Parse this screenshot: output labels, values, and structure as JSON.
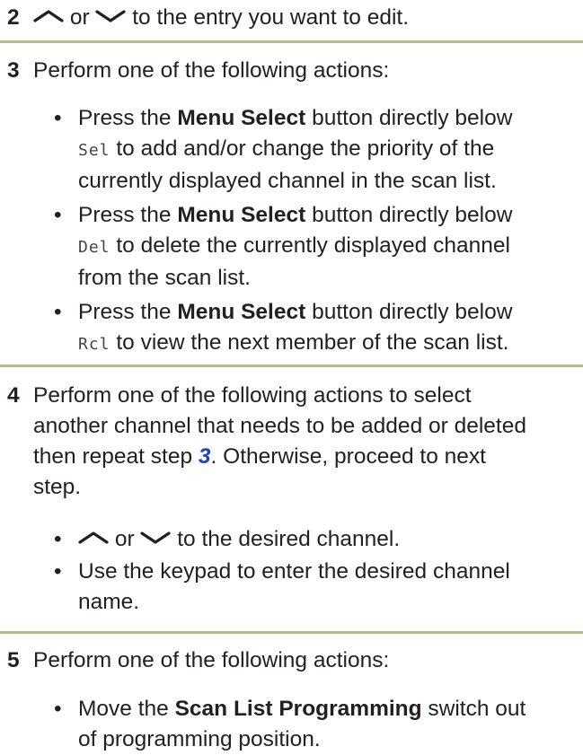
{
  "step2": {
    "number": "2",
    "or": "or",
    "text": "to the entry you want to edit.",
    "up_icon": "chevron-up-icon",
    "down_icon": "chevron-down-icon"
  },
  "step3": {
    "number": "3",
    "text": "Perform one of the following actions:",
    "bullets": [
      {
        "pre": "Press the",
        "bold": "Menu Select",
        "post": "button directly below",
        "key": "Sel",
        "post2": "to add and/or change the priority of the",
        "line3": "currently displayed channel in the scan list."
      },
      {
        "pre": "Press the",
        "bold": "Menu Select",
        "post": "button directly below",
        "key": "Del",
        "post2": "to delete the currently displayed channel",
        "line3": "from the scan list."
      },
      {
        "pre": "Press the",
        "bold": "Menu Select",
        "post": "button directly below",
        "key": "Rcl",
        "post2": "to view the next member of the scan list."
      }
    ]
  },
  "step4": {
    "number": "4",
    "line1": "Perform one of the following actions to select",
    "line2": "another channel that needs to be added or deleted",
    "line3_pre": "then repeat step",
    "link": "3",
    "line3_post": ". Otherwise, proceed to next",
    "line4": "step.",
    "bullets": [
      {
        "or": "or",
        "text": "to the desired channel."
      },
      {
        "line1": "Use the keypad to enter the desired channel",
        "line2": "name."
      }
    ]
  },
  "step5": {
    "number": "5",
    "text": "Perform one of the following actions:",
    "bullets": [
      {
        "pre": "Move the",
        "bold": "Scan List Programming",
        "post": "switch out",
        "line2": "of programming position."
      }
    ]
  },
  "colors": {
    "rule": "#a9c088",
    "link": "#1a3fd1",
    "text": "#231f20"
  }
}
